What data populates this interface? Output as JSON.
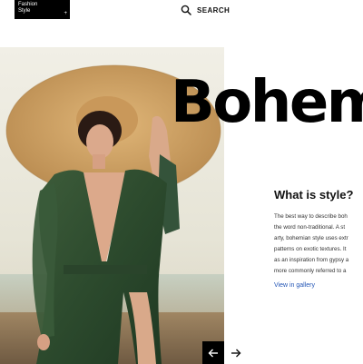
{
  "brand": {
    "line1": "Fashion",
    "line2": "Style",
    "plus_symbol": "+"
  },
  "search": {
    "label": "SEARCH",
    "icon": "search-icon"
  },
  "hero": {
    "alt": "Woman in wide-brimmed straw hat and green dress on a beach",
    "icon": "hero-photo"
  },
  "article": {
    "headline": "Bohem",
    "subtitle": "What is style?",
    "body_lines": [
      "The best way to describe boh",
      "the word non-traditional. A st",
      "arty, bohemian style uses extr",
      "patterns on exotic textures. It",
      "as an inspiration from gypsy a",
      "more commonly referred to a"
    ],
    "link_label": "View in gallery"
  },
  "nav": {
    "prev_icon": "arrow-left-icon",
    "next_icon": "arrow-right-icon"
  },
  "colors": {
    "accent_link": "#2255b5",
    "dress": "#2f4a30",
    "hat": "#d2a566",
    "background": "#ffffff"
  }
}
